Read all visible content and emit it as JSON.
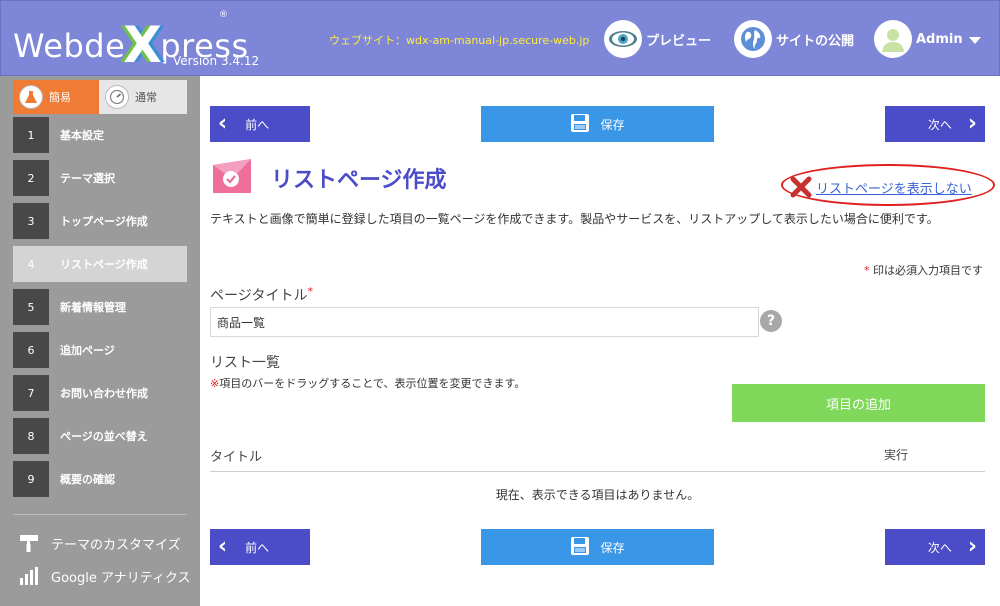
{
  "header": {
    "logo_pre": "Webde",
    "logo_x": "X",
    "logo_post": "press",
    "logo_reg": "®",
    "version": "Version 3.4.12",
    "site_url": "ウェブサイト：wdx-am-manual-jp.secure-web.jp",
    "preview_label": "プレビュー",
    "publish_label": "サイトの公開",
    "admin_label": "Admin"
  },
  "sidebar": {
    "mode_easy": "簡易",
    "mode_normal": "通常",
    "steps": [
      {
        "num": "1",
        "label": "基本設定"
      },
      {
        "num": "2",
        "label": "テーマ選択"
      },
      {
        "num": "3",
        "label": "トップページ作成"
      },
      {
        "num": "4",
        "label": "リストページ作成"
      },
      {
        "num": "5",
        "label": "新着情報管理"
      },
      {
        "num": "6",
        "label": "追加ページ"
      },
      {
        "num": "7",
        "label": "お問い合わせ作成"
      },
      {
        "num": "8",
        "label": "ページの並べ替え"
      },
      {
        "num": "9",
        "label": "概要の確認"
      }
    ],
    "tools": [
      {
        "label": "テーマのカスタマイズ"
      },
      {
        "label": "Google アナリティクス"
      }
    ]
  },
  "nav": {
    "prev_label": "前へ",
    "save_label": "保存",
    "next_label": "次へ"
  },
  "main": {
    "page_title": "リストページ作成",
    "hide_link": "リストページを表示しない",
    "description": "テキストと画像で簡単に登録した項目の一覧ページを作成できます。製品やサービスを、リストアップして表示したい場合に便利です。",
    "required_mark": "*",
    "required_note": " 印は必須入力項目です",
    "page_title_label": "ページタイトル",
    "page_title_value": "商品一覧",
    "help": "?",
    "list_label": "リスト一覧",
    "drag_mark": "※",
    "drag_note": "項目のバーをドラッグすることで、表示位置を変更できます。",
    "add_item": "項目の追加",
    "col_title": "タイトル",
    "col_action": "実行",
    "empty": "現在、表示できる項目はありません。"
  },
  "colors": {
    "header_bg": "#7e86d8",
    "accent_blue": "#4a4cc8",
    "save_blue": "#3a96e6",
    "add_green": "#7fd85a",
    "easy_orange": "#f07b34",
    "sidebar_gray": "#9b9b9b",
    "highlight_red": "#e02020"
  }
}
